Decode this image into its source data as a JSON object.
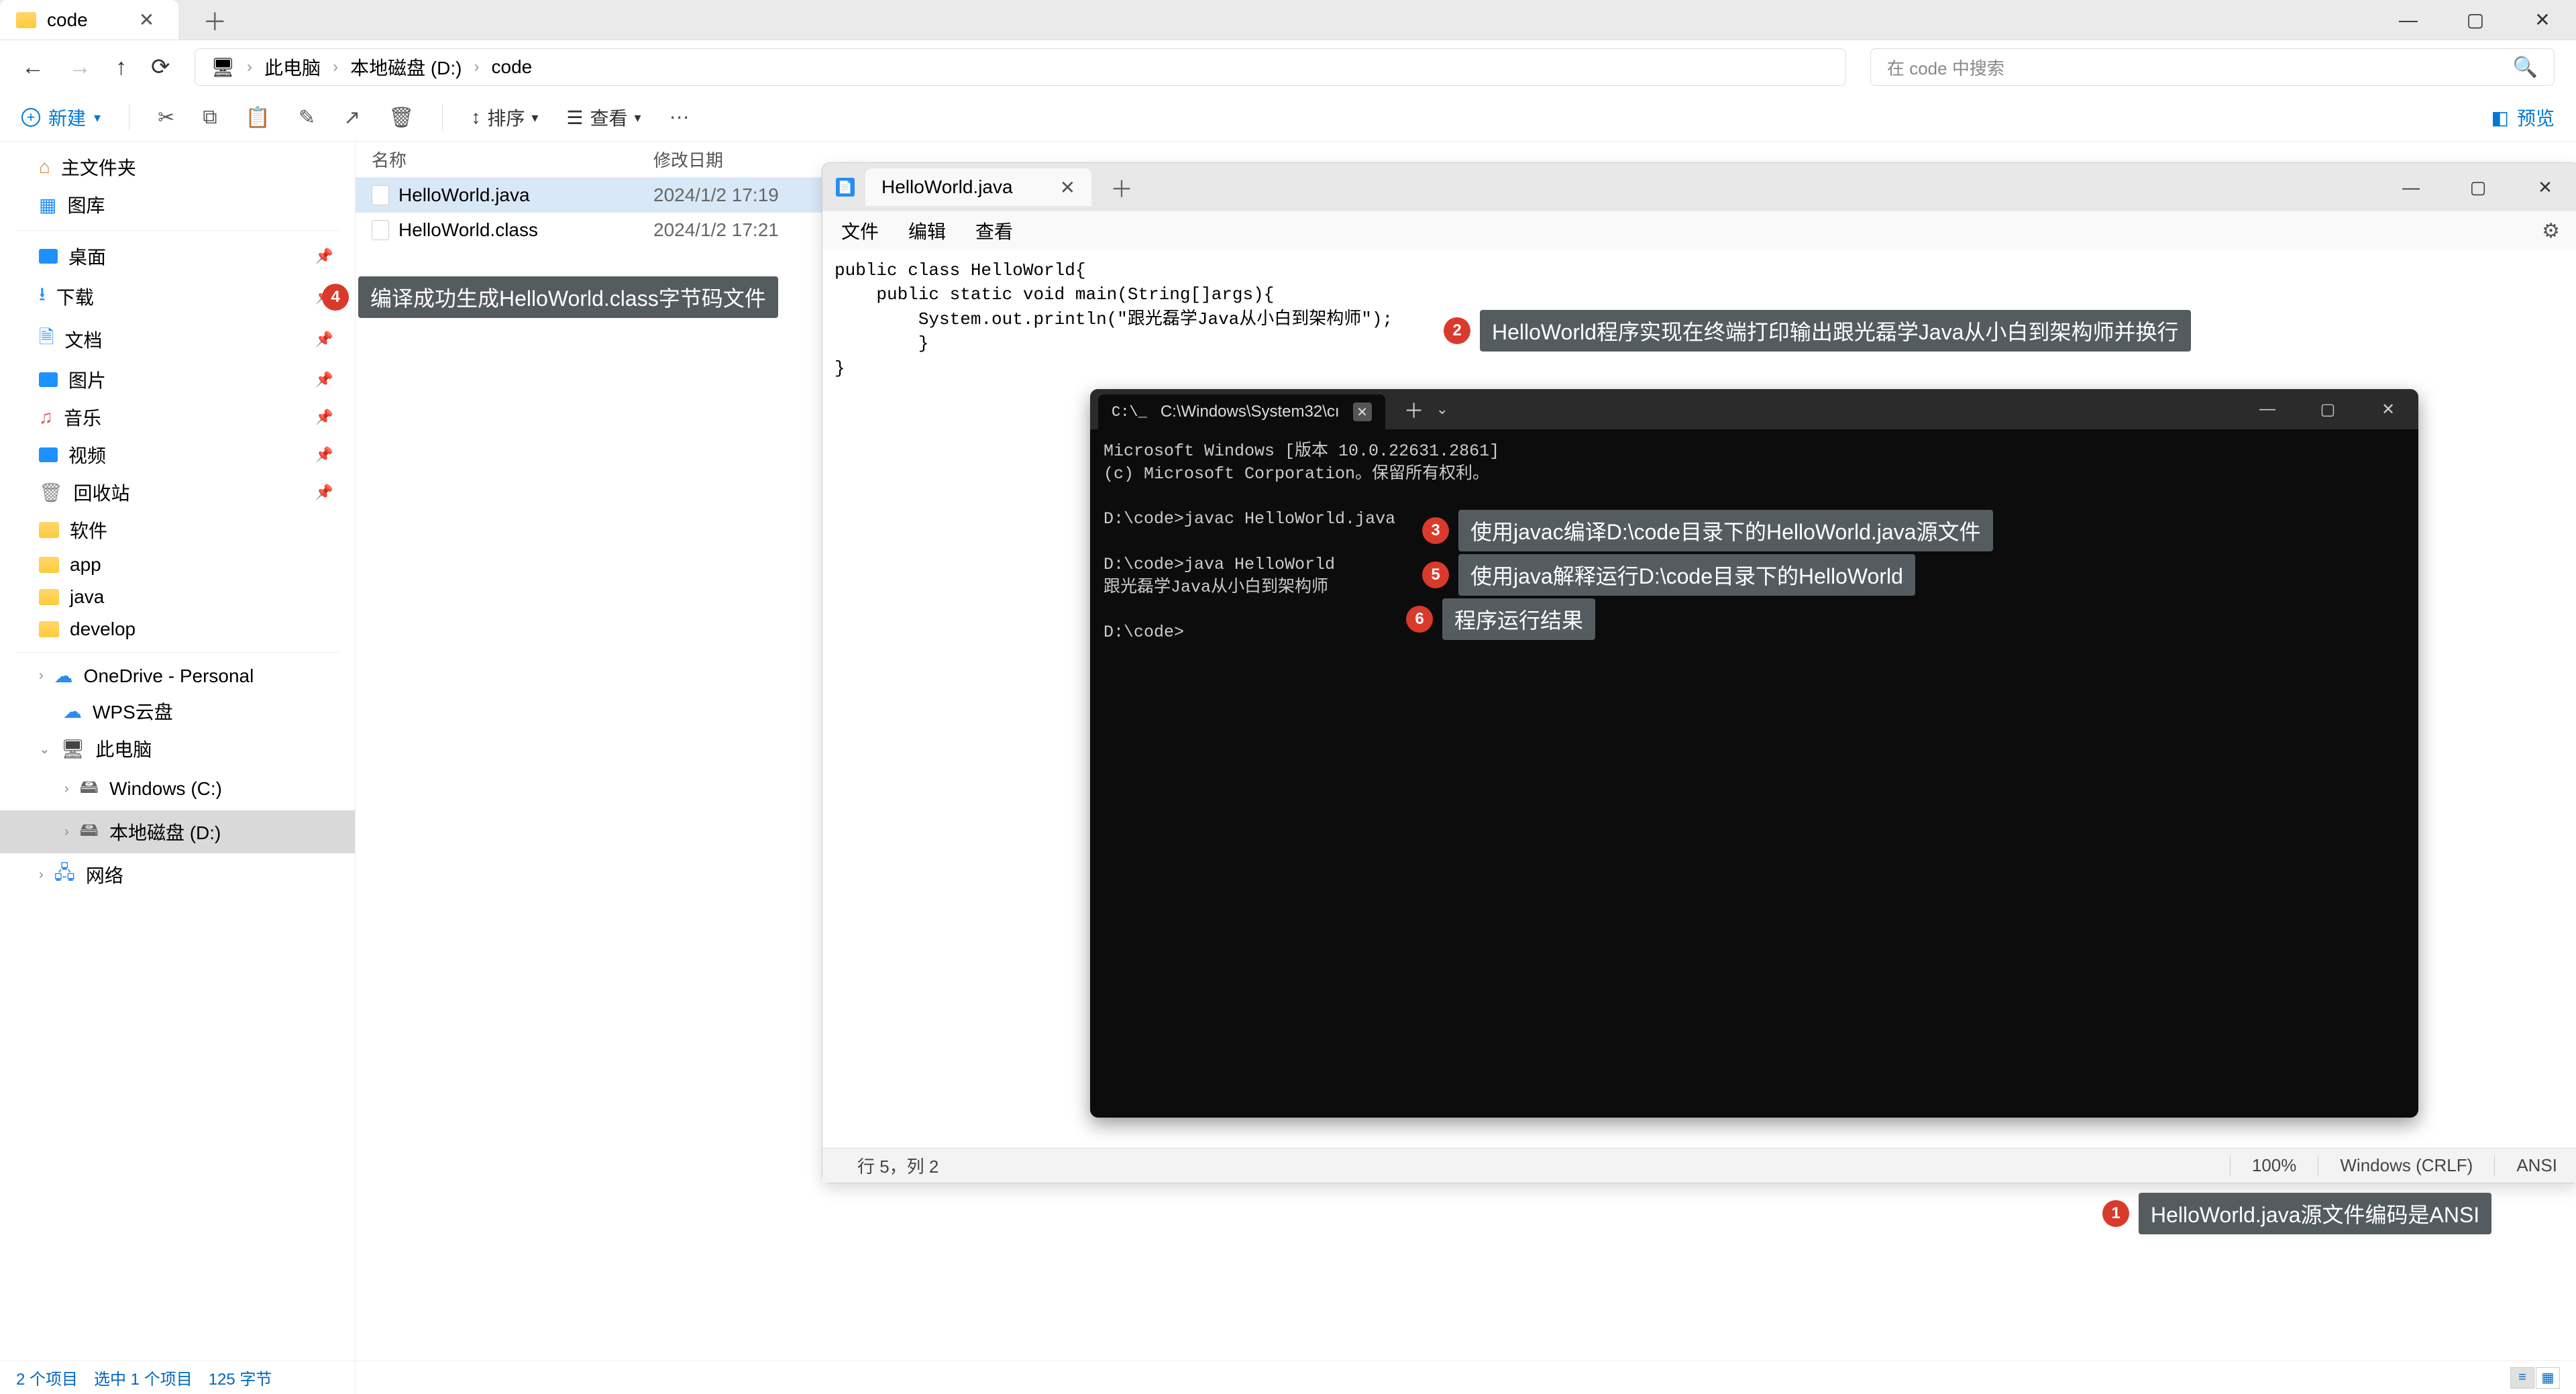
{
  "explorer": {
    "tab_label": "code",
    "search_placeholder": "在 code 中搜索",
    "toolbar": {
      "new": "新建",
      "sort": "排序",
      "view": "查看",
      "preview": "预览"
    },
    "breadcrumb": [
      "此电脑",
      "本地磁盘 (D:)",
      "code"
    ],
    "sidebar": {
      "home": "主文件夹",
      "gallery": "图库",
      "desktop": "桌面",
      "downloads": "下载",
      "documents": "文档",
      "pictures": "图片",
      "music": "音乐",
      "videos": "视频",
      "recycle": "回收站",
      "soft": "软件",
      "app": "app",
      "java": "java",
      "develop": "develop",
      "onedrive": "OneDrive - Personal",
      "wps": "WPS云盘",
      "thispc": "此电脑",
      "cdrive": "Windows (C:)",
      "ddrive": "本地磁盘 (D:)",
      "network": "网络"
    },
    "columns": {
      "name": "名称",
      "date": "修改日期"
    },
    "files": [
      {
        "name": "HelloWorld.java",
        "date": "2024/1/2 17:19"
      },
      {
        "name": "HelloWorld.class",
        "date": "2024/1/2 17:21"
      }
    ],
    "status": "2 个项目　选中 1 个项目　125 字节"
  },
  "notepad": {
    "tab_label": "HelloWorld.java",
    "menu": {
      "file": "文件",
      "edit": "编辑",
      "view": "查看"
    },
    "code": "public class HelloWorld{\n    public static void main(String[]args){\n        System.out.println(\"跟光磊学Java从小白到架构师\");\n        }\n}",
    "status": {
      "pos": "行 5，列 2",
      "zoom": "100%",
      "eol": "Windows (CRLF)",
      "enc": "ANSI"
    }
  },
  "terminal": {
    "tab_label": "C:\\Windows\\System32\\cı",
    "body": "Microsoft Windows [版本 10.0.22631.2861]\n(c) Microsoft Corporation。保留所有权利。\n\nD:\\code>javac HelloWorld.java\n\nD:\\code>java HelloWorld\n跟光磊学Java从小白到架构师\n\nD:\\code>"
  },
  "callouts": {
    "c1": "HelloWorld.java源文件编码是ANSI",
    "c2": "HelloWorld程序实现在终端打印输出跟光磊学Java从小白到架构师并换行",
    "c3": "使用javac编译D:\\code目录下的HelloWorld.java源文件",
    "c4": "编译成功生成HelloWorld.class字节码文件",
    "c5": "使用java解释运行D:\\code目录下的HelloWorld",
    "c6": "程序运行结果"
  }
}
